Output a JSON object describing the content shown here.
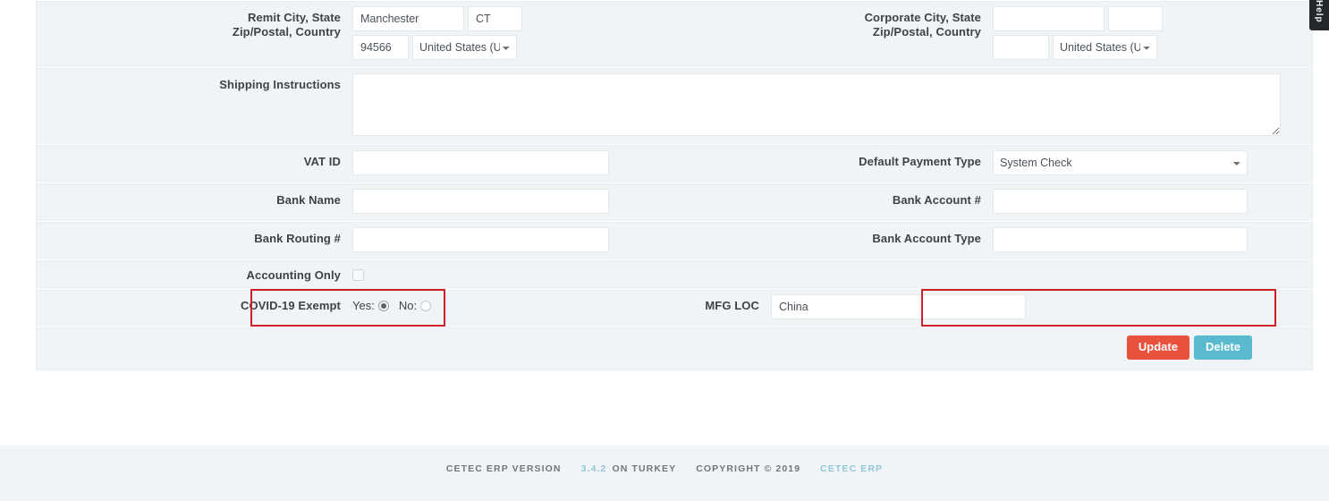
{
  "panel": {
    "top_partial_row": {
      "left_input_value": "",
      "right_input_value": ""
    },
    "rows": [
      {
        "id": "remit-address",
        "left": {
          "label": "Remit City, State\nZip/Postal, Country",
          "label_line1": "Remit City, State",
          "label_line2": "Zip/Postal, Country",
          "city": "Manchester",
          "state": "CT",
          "zip": "94566",
          "country": "United States (US",
          "country_options": [
            "United States (US"
          ]
        },
        "right": {
          "label_line1": "Corporate City, State",
          "label_line2": "Zip/Postal, Country",
          "city": "",
          "state": "",
          "zip": "",
          "country": "United States (US",
          "country_options": [
            "United States (US"
          ]
        }
      },
      {
        "id": "shipping-instructions",
        "label": "Shipping Instructions",
        "value": ""
      },
      {
        "id": "vat-payment",
        "left": {
          "label": "VAT ID",
          "value": ""
        },
        "right": {
          "label": "Default Payment Type",
          "value": "System Check",
          "options": [
            "System Check"
          ]
        }
      },
      {
        "id": "bank-name-account",
        "left": {
          "label": "Bank Name",
          "value": ""
        },
        "right": {
          "label": "Bank Account #",
          "value": ""
        }
      },
      {
        "id": "bank-routing-type",
        "left": {
          "label": "Bank Routing #",
          "value": ""
        },
        "right": {
          "label": "Bank Account Type",
          "value": ""
        }
      },
      {
        "id": "accounting-only",
        "label": "Accounting Only",
        "checked": false
      },
      {
        "id": "covid-mfg",
        "left": {
          "label": "COVID-19 Exempt",
          "yes_label": "Yes:",
          "no_label": "No:",
          "selected": "Yes",
          "highlighted": true
        },
        "right": {
          "label": "MFG LOC",
          "value": "China",
          "highlighted": true
        }
      }
    ],
    "actions": {
      "update_label": "Update",
      "delete_label": "Delete",
      "update_color": "#e8513b",
      "delete_color": "#59b9cf"
    }
  },
  "footer": {
    "version_label": "CETEC ERP VERSION",
    "version_number": "3.4.2",
    "instance_label": "ON TURKEY",
    "copyright": "COPYRIGHT © 2019",
    "brand_link": "CETEC ERP",
    "link_color": "#8fc6d8"
  },
  "help_tab": {
    "label": "Help"
  }
}
